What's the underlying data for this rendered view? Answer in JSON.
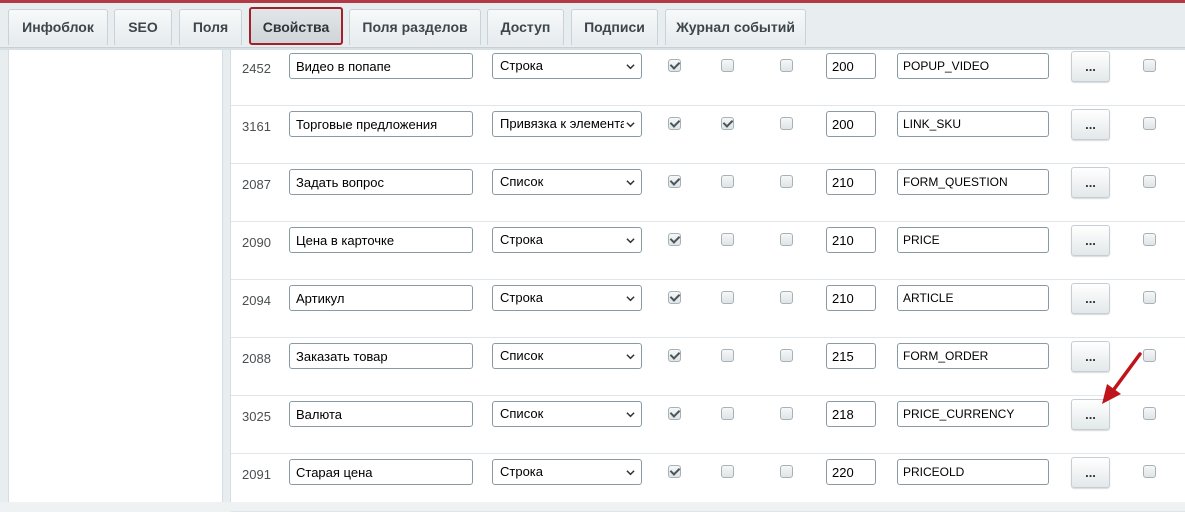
{
  "tabs": [
    {
      "label": "Инфоблок"
    },
    {
      "label": "SEO"
    },
    {
      "label": "Поля"
    },
    {
      "label": "Свойства"
    },
    {
      "label": "Поля разделов"
    },
    {
      "label": "Доступ"
    },
    {
      "label": "Подписи"
    },
    {
      "label": "Журнал событий"
    }
  ],
  "active_tab": "Свойства",
  "more_button_label": "...",
  "colors": {
    "accent": "#a3202a",
    "arrow": "#c0141b"
  },
  "rows": [
    {
      "id": "2452",
      "name": "Видео в попапе",
      "type": "Строка",
      "checks": [
        true,
        false,
        false
      ],
      "sort": "200",
      "code": "POPUP_VIDEO",
      "last": false
    },
    {
      "id": "3161",
      "name": "Торговые предложения",
      "type": "Привязка к элементам",
      "checks": [
        true,
        true,
        false
      ],
      "sort": "200",
      "code": "LINK_SKU",
      "last": false
    },
    {
      "id": "2087",
      "name": "Задать вопрос",
      "type": "Список",
      "checks": [
        true,
        false,
        false
      ],
      "sort": "210",
      "code": "FORM_QUESTION",
      "last": false
    },
    {
      "id": "2090",
      "name": "Цена в карточке",
      "type": "Строка",
      "checks": [
        true,
        false,
        false
      ],
      "sort": "210",
      "code": "PRICE",
      "last": false
    },
    {
      "id": "2094",
      "name": "Артикул",
      "type": "Строка",
      "checks": [
        true,
        false,
        false
      ],
      "sort": "210",
      "code": "ARTICLE",
      "last": false
    },
    {
      "id": "2088",
      "name": "Заказать товар",
      "type": "Список",
      "checks": [
        true,
        false,
        false
      ],
      "sort": "215",
      "code": "FORM_ORDER",
      "last": false
    },
    {
      "id": "3025",
      "name": "Валюта",
      "type": "Список",
      "checks": [
        true,
        false,
        false
      ],
      "sort": "218",
      "code": "PRICE_CURRENCY",
      "last": false
    },
    {
      "id": "2091",
      "name": "Старая цена",
      "type": "Строка",
      "checks": [
        true,
        false,
        false
      ],
      "sort": "220",
      "code": "PRICEOLD",
      "last": false
    }
  ]
}
